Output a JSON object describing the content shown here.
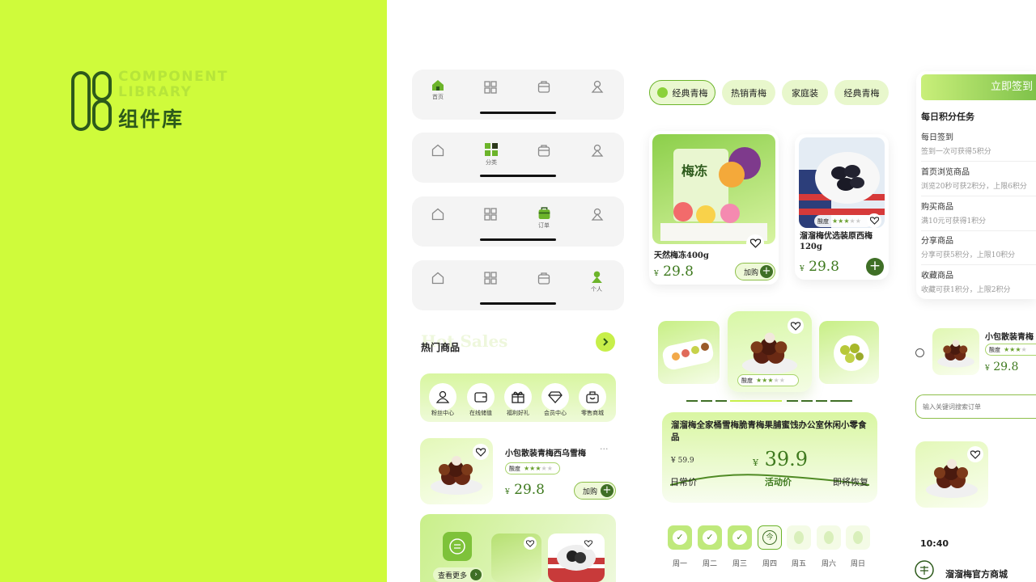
{
  "cover": {
    "number": "08",
    "en_title_line1": "COMPONENT",
    "en_title_line2": "LIBRARY",
    "cn_title": "组件库"
  },
  "tabbars": [
    {
      "active": "home",
      "label": "首页"
    },
    {
      "active": "category",
      "label": "分类"
    },
    {
      "active": "orders",
      "label": "订单"
    },
    {
      "active": "profile",
      "label": "个人"
    }
  ],
  "hot": {
    "ghost": "Hot Sales",
    "title": "热门商品"
  },
  "quick_icons": [
    {
      "icon": "fans-icon",
      "label": "粉丝中心"
    },
    {
      "icon": "wallet-icon",
      "label": "在线储值"
    },
    {
      "icon": "gift-icon",
      "label": "福利好礼"
    },
    {
      "icon": "diamond-icon",
      "label": "会员中心"
    },
    {
      "icon": "bag-icon",
      "label": "零售商城"
    }
  ],
  "list_product": {
    "name": "小包散装青梅西乌雪梅",
    "more": "···",
    "sour_label": "酸度",
    "sour_level": 3,
    "currency": "¥",
    "price": "29.8",
    "add_label": "加购"
  },
  "see_more": "查看更多",
  "filter_pills": [
    "经典青梅",
    "热销青梅",
    "家庭装",
    "经典青梅"
  ],
  "product_cards": [
    {
      "name": "天然梅冻400g",
      "currency": "¥",
      "price": "29.8",
      "add_label": "加购",
      "pkg_text": "梅冻"
    },
    {
      "name": "溜溜梅优选装原西梅120g",
      "currency": "¥",
      "price": "29.8",
      "sour_label": "酸度",
      "sour_level": 3
    }
  ],
  "carousel": {
    "sour_label": "酸度",
    "sour_level": 3
  },
  "deal": {
    "title": "溜溜梅全家桶雪梅脆青梅果脯蜜饯办公室休闲小零食品",
    "old_price": "¥ 59.9",
    "currency": "¥",
    "price": "39.9",
    "left_label": "日常价",
    "mid_label": "活动价",
    "right_label": "即将恢复"
  },
  "checkin_days": [
    {
      "label": "周一",
      "state": "done"
    },
    {
      "label": "周二",
      "state": "done"
    },
    {
      "label": "周三",
      "state": "done"
    },
    {
      "label": "周四",
      "state": "today",
      "mark": "今"
    },
    {
      "label": "周五",
      "state": "future"
    },
    {
      "label": "周六",
      "state": "future"
    },
    {
      "label": "周日",
      "state": "future"
    }
  ],
  "tasks": {
    "button": "立即签到",
    "title": "每日积分任务",
    "items": [
      {
        "name": "每日签到",
        "desc": "签到一次可获得5积分"
      },
      {
        "name": "首页浏览商品",
        "desc": "浏览20秒可获2积分，上限6积分"
      },
      {
        "name": "购买商品",
        "desc": "满10元可获得1积分"
      },
      {
        "name": "分享商品",
        "desc": "分享可获5积分，上限10积分"
      },
      {
        "name": "收藏商品",
        "desc": "收藏可获1积分，上限2积分"
      }
    ]
  },
  "mini_product": {
    "name": "小包散装青梅",
    "sour_label": "酸度",
    "sour_level": 3,
    "currency": "¥",
    "price": "29.8"
  },
  "search": {
    "placeholder": "输入关键词搜索订单"
  },
  "status_time": "10:40",
  "shop_name": "溜溜梅官方商城",
  "colors": {
    "lime": "#cffb3b",
    "dark_green": "#2d5a1b",
    "accent": "#3f7a1f",
    "pale": "#e8f7cc"
  }
}
